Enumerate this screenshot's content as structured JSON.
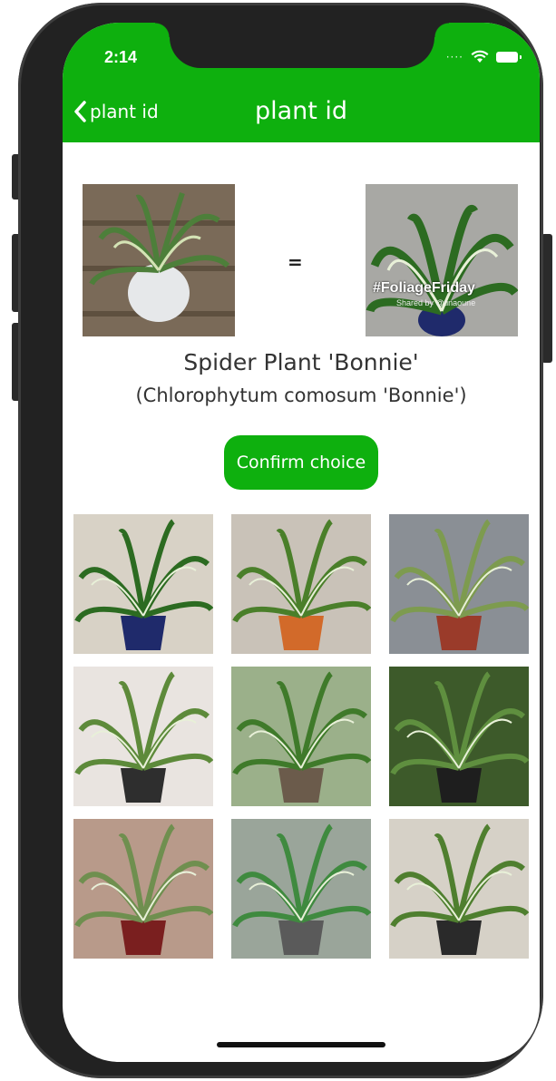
{
  "status_bar": {
    "time": "2:14",
    "signal_icon": "signal-dots-icon",
    "wifi_icon": "wifi-icon",
    "battery_icon": "battery-icon"
  },
  "nav": {
    "back_label": "plant id",
    "title": "plant id",
    "back_icon": "chevron-left-icon"
  },
  "comparison": {
    "equals": "=",
    "match_overlay": "#FoliageFriday",
    "match_overlay_sub": "Shared by @tinaoune"
  },
  "result": {
    "common_name": "Spider Plant 'Bonnie'",
    "scientific_name": "(Chlorophytum comosum 'Bonnie')"
  },
  "actions": {
    "confirm_label": "Confirm choice"
  },
  "colors": {
    "accent": "#0eb00e",
    "frame": "#222222"
  },
  "gallery": {
    "rows": 3,
    "columns": 3,
    "items": [
      {
        "bg": "#d8d2c6",
        "leaf": "#2c6b21",
        "pot": "#1f2a6b"
      },
      {
        "bg": "#c9c2b8",
        "leaf": "#4a7f2a",
        "pot": "#d26a2a"
      },
      {
        "bg": "#8a8f95",
        "leaf": "#7d9b4f",
        "pot": "#9a3b2a"
      },
      {
        "bg": "#e9e4e0",
        "leaf": "#5d8a3a",
        "pot": "#2e2e2e"
      },
      {
        "bg": "#9bb08a",
        "leaf": "#3f7a2a",
        "pot": "#6b5b4b"
      },
      {
        "bg": "#3d5a2a",
        "leaf": "#5f8f3f",
        "pot": "#1e1e1e"
      },
      {
        "bg": "#b89a8a",
        "leaf": "#6f8f4f",
        "pot": "#7a1f1f"
      },
      {
        "bg": "#9aa59a",
        "leaf": "#3f8a3f",
        "pot": "#5a5a5a"
      },
      {
        "bg": "#d6d1c7",
        "leaf": "#4f7f2f",
        "pot": "#2a2a2a"
      }
    ]
  }
}
